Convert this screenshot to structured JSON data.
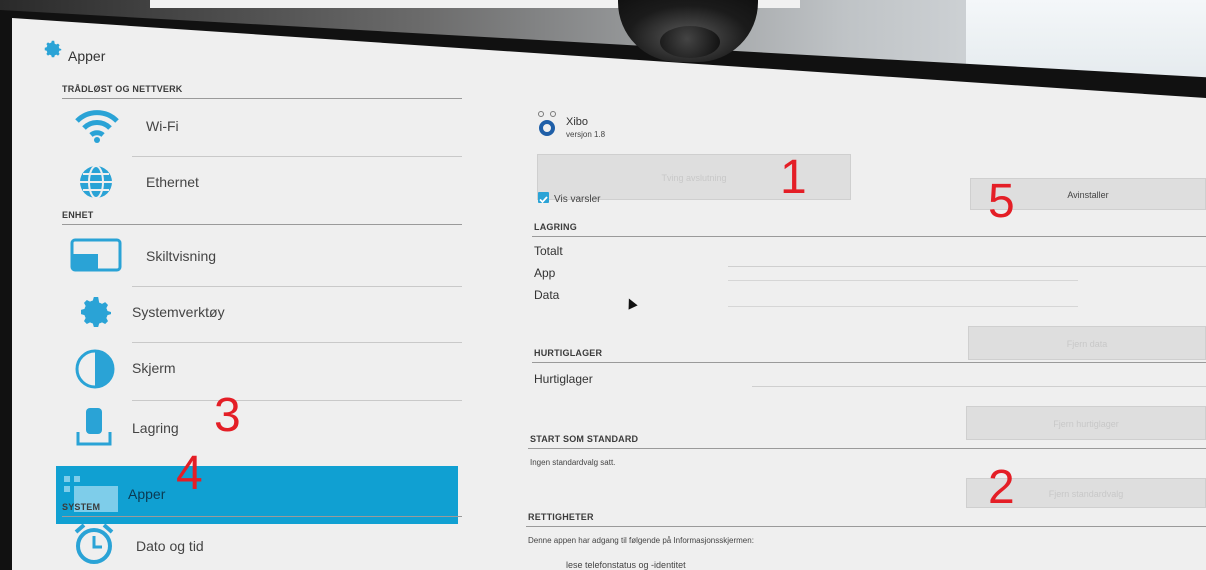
{
  "header": {
    "title": "Apper"
  },
  "sidebar": {
    "sections": {
      "wireless": "TRÅDLØST OG NETTVERK",
      "device": "ENHET",
      "system": "SYSTEM"
    },
    "items": [
      {
        "label": "Wi-Fi"
      },
      {
        "label": "Ethernet"
      },
      {
        "label": "Skiltvisning"
      },
      {
        "label": "Systemverktøy"
      },
      {
        "label": "Skjerm"
      },
      {
        "label": "Lagring"
      },
      {
        "label": "Apper",
        "selected": true
      },
      {
        "label": "Dato og tid"
      }
    ]
  },
  "app": {
    "name": "Xibo",
    "version": "versjon 1.8",
    "force_stop_label": "Tving avslutning",
    "uninstall_label": "Avinstaller",
    "show_notifications_label": "Vis varsler",
    "show_notifications_checked": true
  },
  "storage": {
    "section": "LAGRING",
    "rows": [
      "Totalt",
      "App",
      "Data"
    ],
    "clear_data_label": "Fjern data"
  },
  "cache": {
    "section": "HURTIGLAGER",
    "row": "Hurtiglager",
    "clear_cache_label": "Fjern hurtiglager"
  },
  "defaults": {
    "section": "START SOM STANDARD",
    "text": "Ingen standardvalg satt.",
    "clear_defaults_label": "Fjern standardvalg"
  },
  "permissions": {
    "section": "RETTIGHETER",
    "text": "Denne appen har adgang til følgende på Informasjonsskjermen:",
    "item": "lese telefonstatus og -identitet"
  },
  "annotations": [
    "1",
    "2",
    "3",
    "4",
    "5"
  ],
  "colors": {
    "selected": "#10a0d2",
    "icon_blue": "#2aa3d6",
    "annotation": "#e41e26"
  }
}
